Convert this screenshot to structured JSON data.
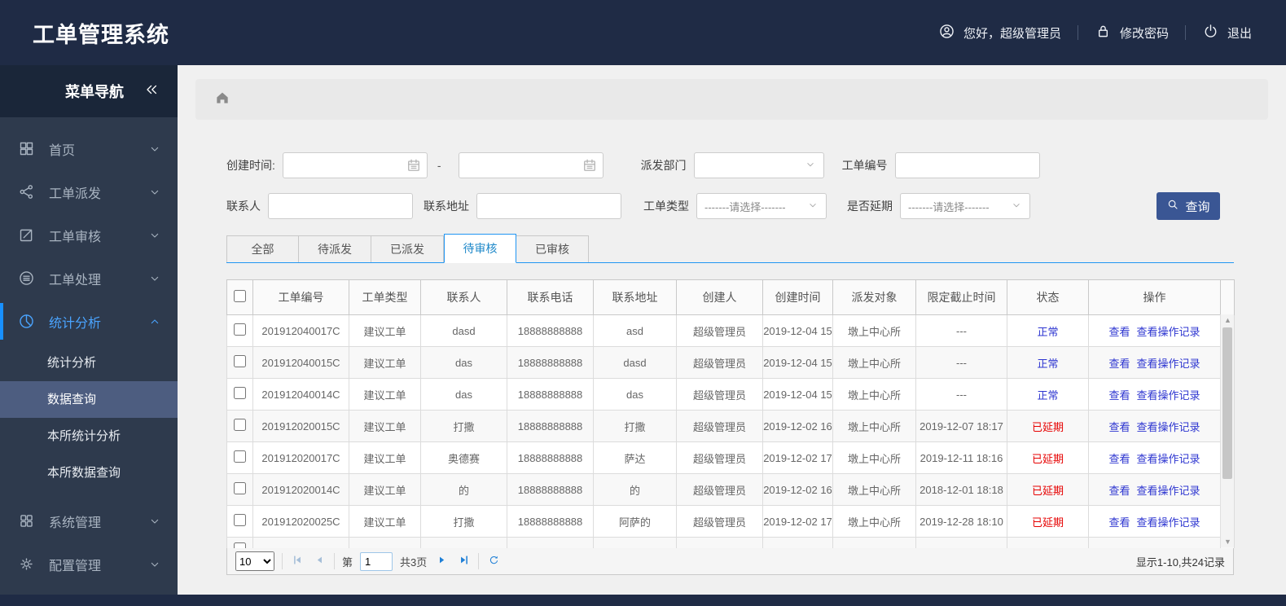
{
  "header": {
    "title": "工单管理系统",
    "greeting": "您好，超级管理员",
    "change_password": "修改密码",
    "logout": "退出"
  },
  "sidebar": {
    "title": "菜单导航",
    "items": [
      {
        "key": "home",
        "icon": "grid",
        "label": "首页"
      },
      {
        "key": "dispatch",
        "icon": "share",
        "label": "工单派发"
      },
      {
        "key": "review",
        "icon": "edit",
        "label": "工单审核"
      },
      {
        "key": "process",
        "icon": "process",
        "label": "工单处理"
      },
      {
        "key": "stats",
        "icon": "pie",
        "label": "统计分析",
        "expanded": true,
        "children": [
          {
            "key": "stats-analysis",
            "label": "统计分析"
          },
          {
            "key": "data-query",
            "label": "数据查询",
            "active": true
          },
          {
            "key": "branch-stats",
            "label": "本所统计分析"
          },
          {
            "key": "branch-query",
            "label": "本所数据查询"
          }
        ]
      },
      {
        "key": "system",
        "icon": "apps",
        "label": "系统管理"
      },
      {
        "key": "config",
        "icon": "gear",
        "label": "配置管理"
      }
    ]
  },
  "filters": {
    "create_time_label": "创建时间:",
    "date_from_value": "",
    "date_separator": "-",
    "date_to_value": "",
    "dispatch_dept_label": "派发部门",
    "dispatch_dept_value": "",
    "order_no_label": "工单编号",
    "order_no_value": "",
    "contact_label": "联系人",
    "contact_value": "",
    "address_label": "联系地址",
    "address_value": "",
    "order_type_label": "工单类型",
    "order_type_value": "-------请选择-------",
    "delay_label": "是否延期",
    "delay_value": "-------请选择-------",
    "search_button": "查询"
  },
  "tabs": [
    {
      "key": "all",
      "label": "全部"
    },
    {
      "key": "pending-dispatch",
      "label": "待派发"
    },
    {
      "key": "dispatched",
      "label": "已派发"
    },
    {
      "key": "pending-review",
      "label": "待审核",
      "active": true
    },
    {
      "key": "reviewed",
      "label": "已审核"
    }
  ],
  "table": {
    "headers": [
      "工单编号",
      "工单类型",
      "联系人",
      "联系电话",
      "联系地址",
      "创建人",
      "创建时间",
      "派发对象",
      "限定截止时间",
      "状态",
      "操作"
    ],
    "actions": [
      "查看",
      "查看操作记录"
    ],
    "rows": [
      {
        "no": "201912040017C",
        "type": "建议工单",
        "contact": "dasd",
        "phone": "18888888888",
        "address": "asd",
        "creator": "超级管理员",
        "created": "2019-12-04 15",
        "target": "墩上中心所",
        "deadline": "---",
        "status": "正常",
        "status_type": "normal"
      },
      {
        "no": "201912040015C",
        "type": "建议工单",
        "contact": "das",
        "phone": "18888888888",
        "address": "dasd",
        "creator": "超级管理员",
        "created": "2019-12-04 15",
        "target": "墩上中心所",
        "deadline": "---",
        "status": "正常",
        "status_type": "normal"
      },
      {
        "no": "201912040014C",
        "type": "建议工单",
        "contact": "das",
        "phone": "18888888888",
        "address": "das",
        "creator": "超级管理员",
        "created": "2019-12-04 15",
        "target": "墩上中心所",
        "deadline": "---",
        "status": "正常",
        "status_type": "normal"
      },
      {
        "no": "201912020015C",
        "type": "建议工单",
        "contact": "打撒",
        "phone": "18888888888",
        "address": "打撒",
        "creator": "超级管理员",
        "created": "2019-12-02 16",
        "target": "墩上中心所",
        "deadline": "2019-12-07 18:17",
        "status": "已延期",
        "status_type": "delayed"
      },
      {
        "no": "201912020017C",
        "type": "建议工单",
        "contact": "奥德赛",
        "phone": "18888888888",
        "address": "萨达",
        "creator": "超级管理员",
        "created": "2019-12-02 17",
        "target": "墩上中心所",
        "deadline": "2019-12-11 18:16",
        "status": "已延期",
        "status_type": "delayed"
      },
      {
        "no": "201912020014C",
        "type": "建议工单",
        "contact": "的",
        "phone": "18888888888",
        "address": "的",
        "creator": "超级管理员",
        "created": "2019-12-02 16",
        "target": "墩上中心所",
        "deadline": "2018-12-01 18:18",
        "status": "已延期",
        "status_type": "delayed"
      },
      {
        "no": "201912020025C",
        "type": "建议工单",
        "contact": "打撒",
        "phone": "18888888888",
        "address": "阿萨的",
        "creator": "超级管理员",
        "created": "2019-12-02 17",
        "target": "墩上中心所",
        "deadline": "2019-12-28 18:10",
        "status": "已延期",
        "status_type": "delayed"
      }
    ],
    "clipped_row_visible": true
  },
  "pagination": {
    "page_size": "10",
    "page_prefix": "第",
    "current_page": "1",
    "total_pages": "共3页",
    "summary": "显示1-10,共24记录"
  },
  "colors": {
    "navy": "#1f2b45",
    "accent_blue": "#1890ff",
    "tab_blue": "#2196f3",
    "link_blue": "#2d35d0",
    "status_delayed_red": "#e60000",
    "query_button": "#3a5694",
    "submenu_active": "#4d5d80"
  }
}
